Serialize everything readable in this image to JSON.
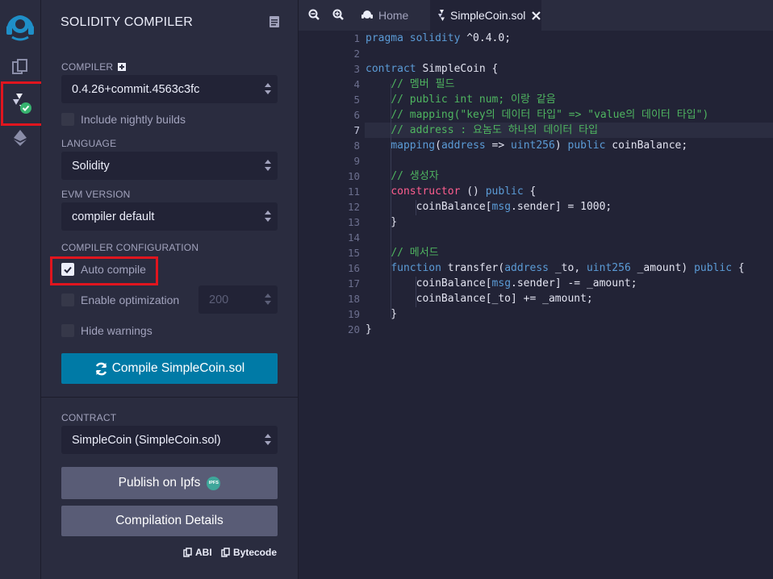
{
  "sidebar": {
    "title": "SOLIDITY COMPILER"
  },
  "compiler": {
    "label": "COMPILER",
    "version": "0.4.26+commit.4563c3fc",
    "nightly_label": "Include nightly builds"
  },
  "language": {
    "label": "LANGUAGE",
    "value": "Solidity"
  },
  "evm": {
    "label": "EVM VERSION",
    "value": "compiler default"
  },
  "config": {
    "label": "COMPILER CONFIGURATION",
    "auto_compile": "Auto compile",
    "enable_optimization": "Enable optimization",
    "runs": "200",
    "hide_warnings": "Hide warnings"
  },
  "compile_button": "Compile SimpleCoin.sol",
  "contract": {
    "label": "CONTRACT",
    "value": "SimpleCoin (SimpleCoin.sol)"
  },
  "publish_button": "Publish on Ipfs",
  "ipfs_badge": "IPFS",
  "details_button": "Compilation Details",
  "links": {
    "abi": "ABI",
    "bytecode": "Bytecode"
  },
  "tabs": [
    {
      "label": "Home"
    },
    {
      "label": "SimpleCoin.sol"
    }
  ],
  "editor": {
    "line_numbers": [
      "1",
      "2",
      "3",
      "4",
      "5",
      "6",
      "7",
      "8",
      "9",
      "10",
      "11",
      "12",
      "13",
      "14",
      "15",
      "16",
      "17",
      "18",
      "19",
      "20"
    ],
    "current_line": 7,
    "lines": [
      [
        [
          "kw",
          "pragma solidity"
        ],
        [
          "tx",
          " ^0.4.0;"
        ]
      ],
      [],
      [
        [
          "kw",
          "contract"
        ],
        [
          "tx",
          " SimpleCoin {"
        ]
      ],
      [
        [
          "tx",
          "    "
        ],
        [
          "cm",
          "// 멤버 필드"
        ]
      ],
      [
        [
          "tx",
          "    "
        ],
        [
          "cm",
          "// public int num; 이랑 같음"
        ]
      ],
      [
        [
          "tx",
          "    "
        ],
        [
          "cm",
          "// mapping(\"key의 데이터 타입\" => \"value의 데이터 타입\")"
        ]
      ],
      [
        [
          "tx",
          "    "
        ],
        [
          "cm",
          "// address : 요놈도 하나의 데이터 타입"
        ]
      ],
      [
        [
          "tx",
          "    "
        ],
        [
          "kw",
          "mapping"
        ],
        [
          "tx",
          "("
        ],
        [
          "kw",
          "address"
        ],
        [
          "tx",
          " => "
        ],
        [
          "kw",
          "uint256"
        ],
        [
          "tx",
          ") "
        ],
        [
          "kw",
          "public"
        ],
        [
          "tx",
          " coinBalance;"
        ]
      ],
      [],
      [
        [
          "tx",
          "    "
        ],
        [
          "cm",
          "// 생성자"
        ]
      ],
      [
        [
          "tx",
          "    "
        ],
        [
          "pk",
          "constructor"
        ],
        [
          "tx",
          " () "
        ],
        [
          "kw",
          "public"
        ],
        [
          "tx",
          " {"
        ]
      ],
      [
        [
          "tx",
          "        coinBalance["
        ],
        [
          "kw",
          "msg"
        ],
        [
          "tx",
          ".sender] = 1000;"
        ]
      ],
      [
        [
          "tx",
          "    }"
        ]
      ],
      [],
      [
        [
          "tx",
          "    "
        ],
        [
          "cm",
          "// 메서드"
        ]
      ],
      [
        [
          "tx",
          "    "
        ],
        [
          "kw",
          "function"
        ],
        [
          "tx",
          " transfer("
        ],
        [
          "kw",
          "address"
        ],
        [
          "tx",
          " _to, "
        ],
        [
          "kw",
          "uint256"
        ],
        [
          "tx",
          " _amount) "
        ],
        [
          "kw",
          "public"
        ],
        [
          "tx",
          " {"
        ]
      ],
      [
        [
          "tx",
          "        coinBalance["
        ],
        [
          "kw",
          "msg"
        ],
        [
          "tx",
          ".sender] -= _amount;"
        ]
      ],
      [
        [
          "tx",
          "        coinBalance[_to] += _amount;"
        ]
      ],
      [
        [
          "tx",
          "    }"
        ]
      ],
      [
        [
          "tx",
          "}"
        ]
      ]
    ]
  },
  "colors": {
    "keyword": "#5b9bd6",
    "comment": "#4fb560",
    "constructor": "#ff5e8f",
    "text": "#e2e3f0",
    "accent": "#007aa6",
    "highlight_box": "#e0151e"
  }
}
